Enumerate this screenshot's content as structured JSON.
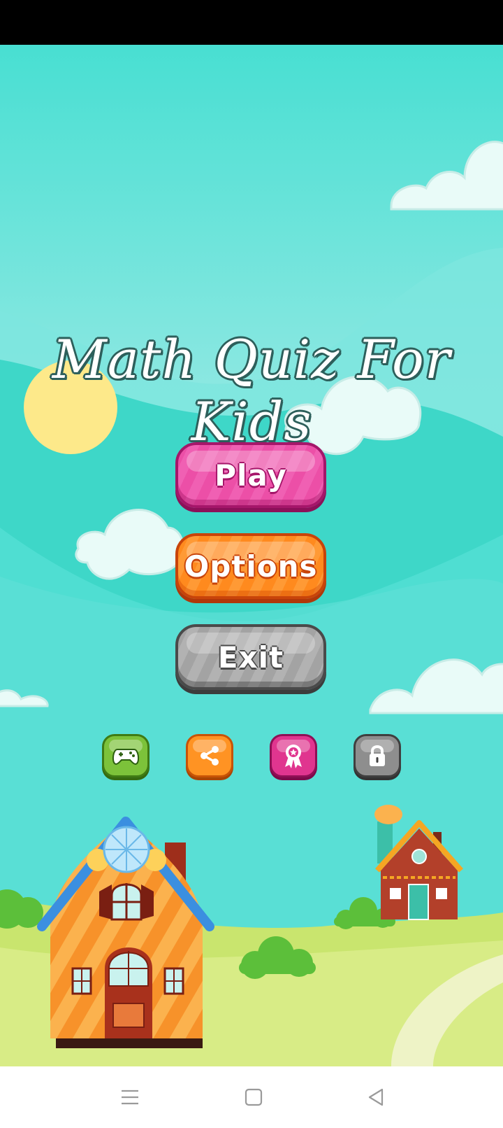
{
  "app": {
    "title": "Math Quiz For Kids"
  },
  "menu": {
    "play_label": "Play",
    "options_label": "Options",
    "exit_label": "Exit"
  },
  "icon_buttons": [
    {
      "icon": "gamepad-icon",
      "color": "#7cc23a"
    },
    {
      "icon": "share-icon",
      "color": "#ff9323"
    },
    {
      "icon": "award-ribbon-icon",
      "color": "#e0358f"
    },
    {
      "icon": "lock-icon",
      "color": "#8e8e8e"
    }
  ],
  "nav": {
    "icons": [
      "menu-lines-icon",
      "home-square-icon",
      "back-triangle-icon"
    ]
  },
  "colors": {
    "sky": "#4fe0d3",
    "play": "#ec4fa7",
    "options": "#ff8a1e",
    "exit": "#a3a3a3",
    "title_outline": "#2d5f5b"
  }
}
